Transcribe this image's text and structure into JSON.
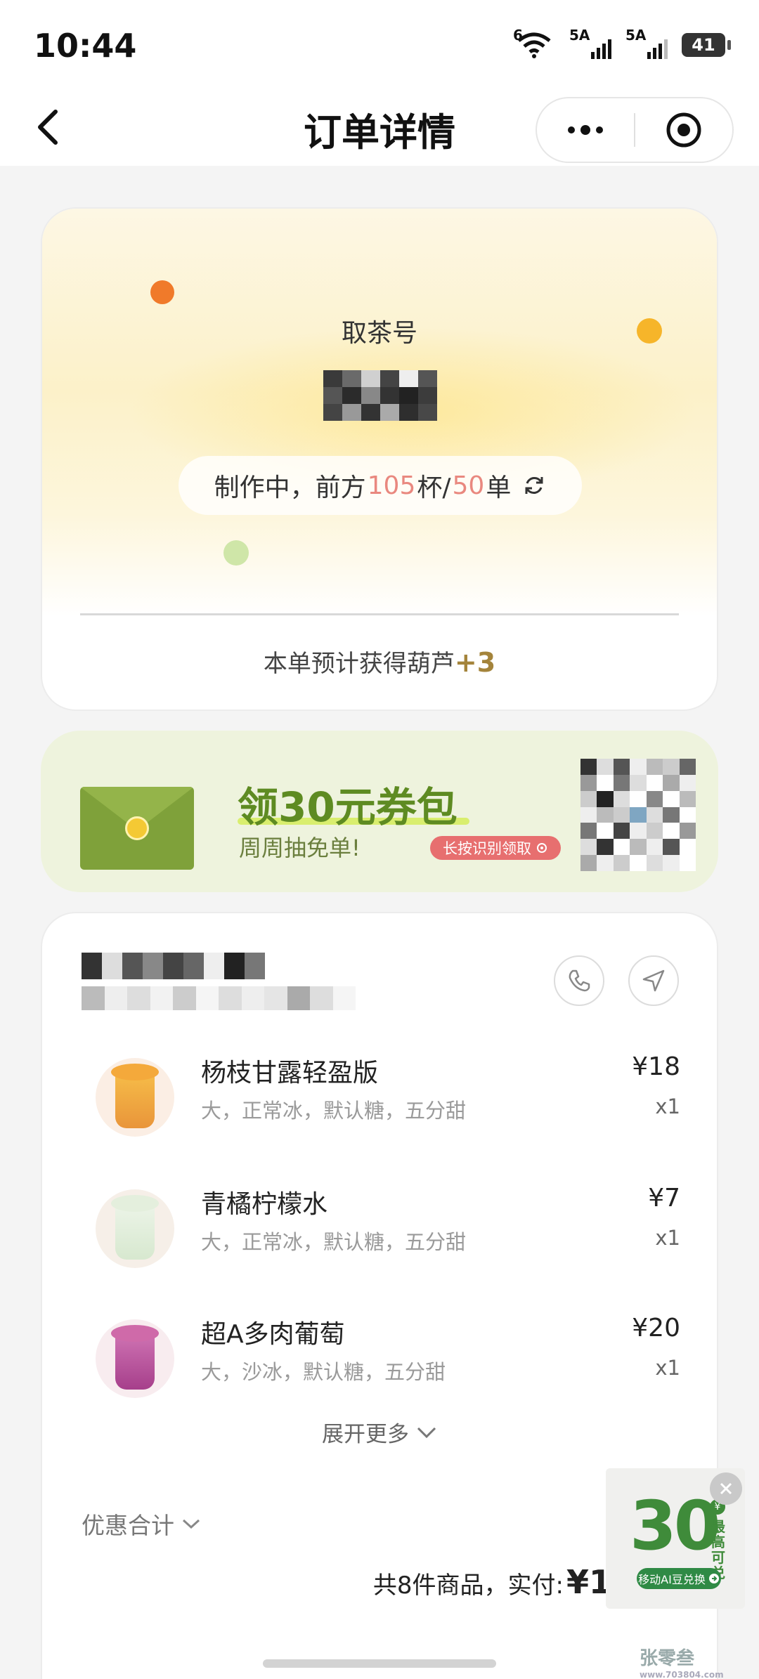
{
  "status_bar": {
    "time": "10:44",
    "wifi_label": "6",
    "sim1_label": "5A",
    "sim2_label": "5A",
    "battery": "41"
  },
  "nav": {
    "title": "订单详情",
    "back_icon": "chevron-left-icon",
    "more_icon": "more-dots-icon",
    "close_icon": "target-circle-icon"
  },
  "pickup": {
    "label": "取茶号",
    "status_prefix": "制作中，前方",
    "cups_ahead": "105",
    "cups_unit": "杯/",
    "orders_ahead": "50",
    "orders_unit": "单",
    "refresh_icon": "refresh-icon",
    "reward_text": "本单预计获得葫芦",
    "reward_value": "+3"
  },
  "coupon": {
    "title": "领30元券包",
    "subtitle": "周周抽免单!",
    "button_label": "长按识别领取"
  },
  "store": {
    "phone_icon": "phone-icon",
    "navigate_icon": "navigate-arrow-icon"
  },
  "items": [
    {
      "name": "杨枝甘露轻盈版",
      "spec": "大，正常冰，默认糖，五分甜",
      "price": "¥18",
      "qty": "x1"
    },
    {
      "name": "青橘柠檬水",
      "spec": "大，正常冰，默认糖，五分甜",
      "price": "¥7",
      "qty": "x1"
    },
    {
      "name": "超A多肉葡萄",
      "spec": "大，沙冰，默认糖，五分甜",
      "price": "¥20",
      "qty": "x1"
    }
  ],
  "expand_label": "展开更多",
  "discount_label": "优惠合计",
  "total": {
    "prefix": "共8件商品，实付:",
    "amount": "¥1"
  },
  "float_ad": {
    "number": "30",
    "badge": "¥",
    "side_text": "最高可兑",
    "button": "移动AI豆兑换"
  },
  "watermark": {
    "text": "张零叁",
    "sub": "www.703804.com"
  },
  "colors": {
    "accent_red": "#e9887f",
    "brand_green": "#5e8b22",
    "reward_gold": "#a4843b"
  }
}
